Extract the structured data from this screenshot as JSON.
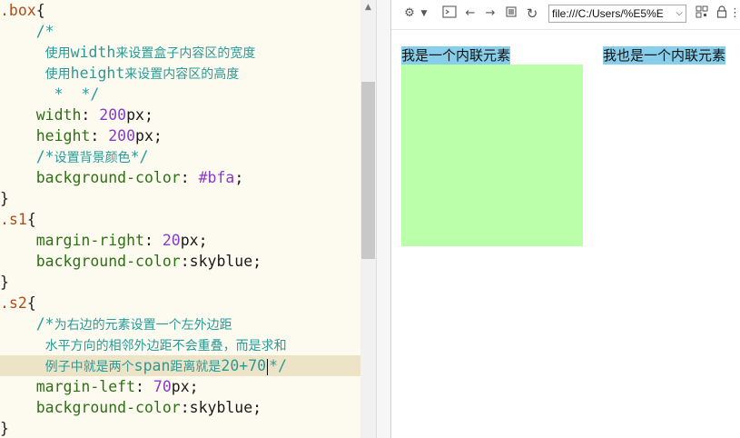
{
  "editor": {
    "lines": [
      {
        "segs": [
          [
            "sel",
            ".box"
          ],
          [
            "brace",
            "{"
          ]
        ]
      },
      {
        "segs": [
          [
            "sp",
            "    "
          ],
          [
            "cmm",
            "/*"
          ]
        ]
      },
      {
        "segs": [
          [
            "sp",
            "     "
          ],
          [
            "cm",
            "使用"
          ],
          [
            "cmb",
            "width"
          ],
          [
            "cm",
            "来设置盒子内容区的宽度"
          ]
        ]
      },
      {
        "segs": [
          [
            "sp",
            "     "
          ],
          [
            "cm",
            "使用"
          ],
          [
            "cmb",
            "height"
          ],
          [
            "cm",
            "来设置内容区的高度"
          ]
        ]
      },
      {
        "segs": [
          [
            "sp",
            "      "
          ],
          [
            "cmm",
            "*  */"
          ]
        ]
      },
      {
        "segs": [
          [
            "sp",
            "    "
          ],
          [
            "prop",
            "width"
          ],
          [
            "unit",
            ": "
          ],
          [
            "num",
            "200"
          ],
          [
            "unit",
            "px;"
          ]
        ]
      },
      {
        "segs": [
          [
            "sp",
            "    "
          ],
          [
            "prop",
            "height"
          ],
          [
            "unit",
            ": "
          ],
          [
            "num",
            "200"
          ],
          [
            "unit",
            "px;"
          ]
        ]
      },
      {
        "segs": [
          [
            "sp",
            "    "
          ],
          [
            "cmm",
            "/*"
          ],
          [
            "cm",
            "设置背景颜色"
          ],
          [
            "cmm",
            "*/"
          ]
        ]
      },
      {
        "segs": [
          [
            "sp",
            "    "
          ],
          [
            "prop",
            "background-color"
          ],
          [
            "unit",
            ": "
          ],
          [
            "hex",
            "#bfa"
          ],
          [
            "unit",
            ";"
          ]
        ]
      },
      {
        "segs": [
          [
            "brace",
            "}"
          ]
        ]
      },
      {
        "segs": [
          [
            "sel",
            ".s1"
          ],
          [
            "brace",
            "{"
          ]
        ]
      },
      {
        "segs": [
          [
            "sp",
            "    "
          ],
          [
            "prop",
            "margin-right"
          ],
          [
            "unit",
            ": "
          ],
          [
            "num",
            "20"
          ],
          [
            "unit",
            "px;"
          ]
        ]
      },
      {
        "segs": [
          [
            "sp",
            "    "
          ],
          [
            "prop",
            "background-color"
          ],
          [
            "unit",
            ":skyblue;"
          ]
        ]
      },
      {
        "segs": [
          [
            "brace",
            "}"
          ]
        ]
      },
      {
        "segs": [
          [
            "sel",
            ".s2"
          ],
          [
            "brace",
            "{"
          ]
        ]
      },
      {
        "segs": [
          [
            "sp",
            "    "
          ],
          [
            "cmm",
            "/*"
          ],
          [
            "cm",
            "为右边的元素设置一个左外边距"
          ]
        ]
      },
      {
        "segs": [
          [
            "sp",
            "     "
          ],
          [
            "cm",
            "水平方向的相邻外边距不会重叠，而是求和"
          ]
        ]
      },
      {
        "segs": [
          [
            "sp",
            "     "
          ],
          [
            "cm",
            "例子中就是两个"
          ],
          [
            "cmb",
            "span"
          ],
          [
            "cm",
            "距离就是"
          ],
          [
            "cmb",
            "20+70"
          ],
          [
            "caret",
            ""
          ],
          [
            "cmm",
            "*/"
          ]
        ],
        "hl": true
      },
      {
        "segs": [
          [
            "sp",
            "    "
          ],
          [
            "prop",
            "margin-left"
          ],
          [
            "unit",
            ": "
          ],
          [
            "num",
            "70"
          ],
          [
            "unit",
            "px;"
          ]
        ]
      },
      {
        "segs": [
          [
            "sp",
            "    "
          ],
          [
            "prop",
            "background-color"
          ],
          [
            "unit",
            ":skyblue;"
          ]
        ]
      },
      {
        "segs": [
          [
            "brace",
            "}"
          ]
        ]
      }
    ]
  },
  "colors": {
    "box_bg": "#bbffaa",
    "inline_bg": "#87ceeb",
    "editor_bg": "#fdfbf0",
    "current_line": "#ede4c7"
  },
  "browser": {
    "address": "file:///C:/Users/%E5%E",
    "toolbar_icons": [
      "gear-icon",
      "dropdown-icon",
      "console-icon",
      "back-icon",
      "forward-icon",
      "stop-icon",
      "refresh-icon",
      "qr-icon",
      "lock-icon",
      "more-icon"
    ]
  },
  "page": {
    "span1": "我是一个内联元素",
    "span2": "我也是一个内联元素"
  }
}
